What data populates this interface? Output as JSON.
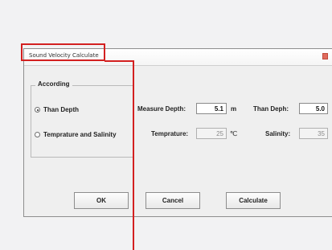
{
  "window": {
    "title": "Sound Velocity Calculate"
  },
  "group": {
    "legend": "According",
    "options": [
      {
        "label": "Than Depth",
        "selected": true
      },
      {
        "label": "Temprature and Salinity",
        "selected": false
      }
    ]
  },
  "fields": {
    "measure_depth": {
      "label": "Measure Depth:",
      "value": "5.1",
      "unit": "m"
    },
    "than_depth": {
      "label": "Than Deph:",
      "value": "5.0"
    },
    "temperature": {
      "label": "Temprature:",
      "value": "25",
      "unit": "℃"
    },
    "salinity": {
      "label": "Salinity:",
      "value": "35"
    }
  },
  "buttons": {
    "ok": "OK",
    "cancel": "Cancel",
    "calculate": "Calculate"
  },
  "colors": {
    "annotation": "#d32020",
    "close_button": "#e06b5d"
  }
}
